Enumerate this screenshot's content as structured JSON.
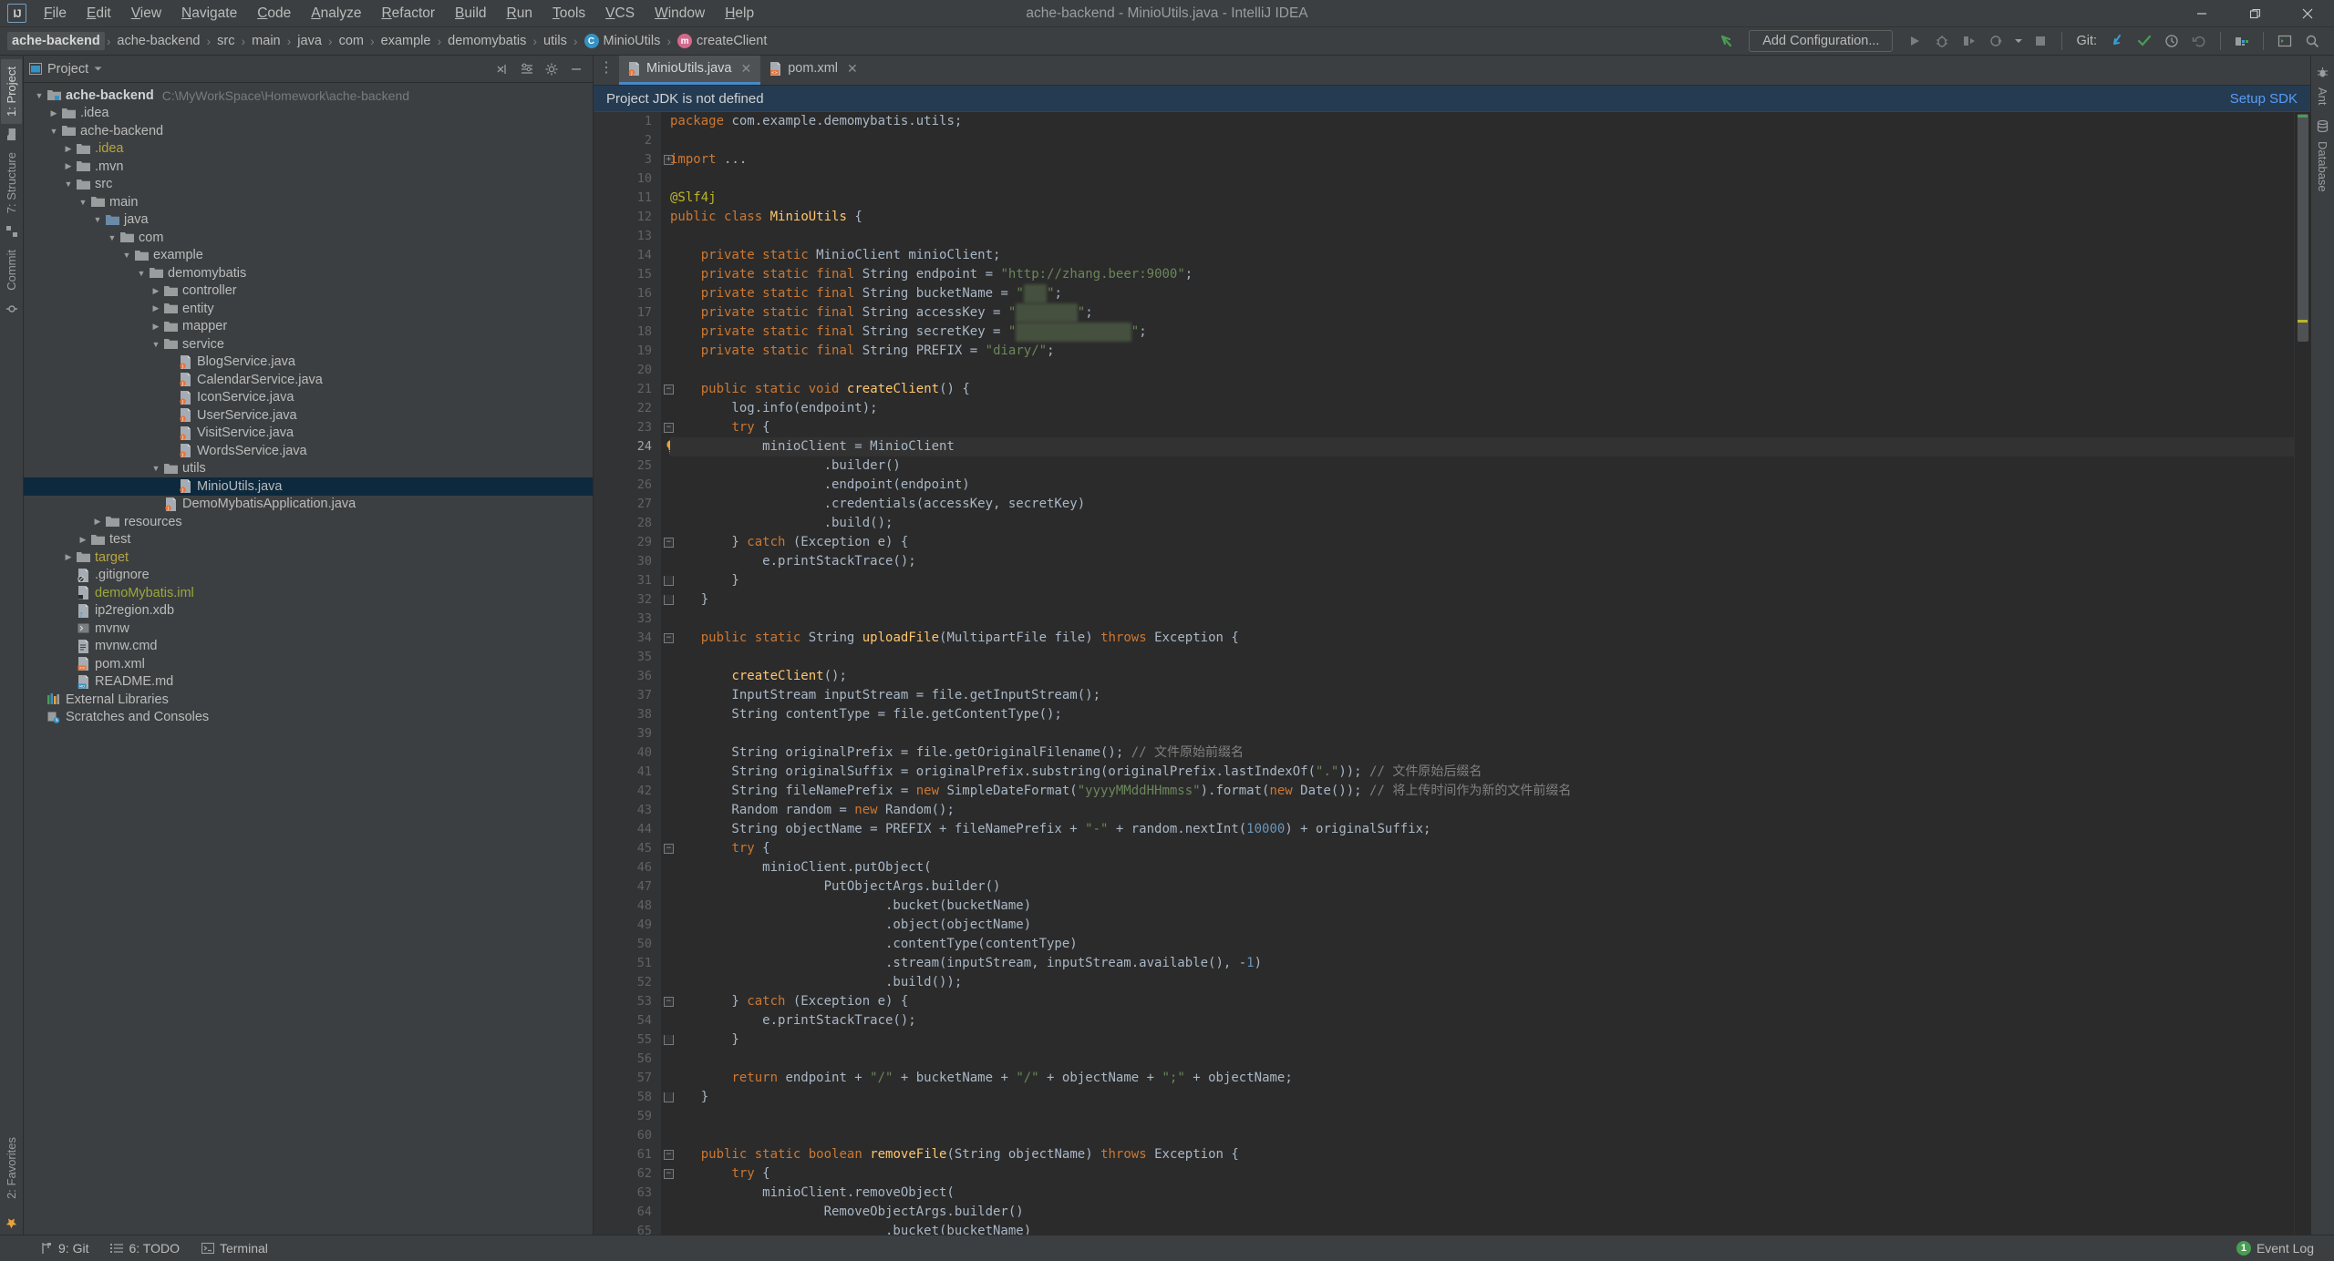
{
  "window": {
    "title": "ache-backend - MinioUtils.java - IntelliJ IDEA",
    "logo": "IJ",
    "minimize": "—",
    "maximize": "❐",
    "close": "✕"
  },
  "menu": {
    "items": [
      "File",
      "Edit",
      "View",
      "Navigate",
      "Code",
      "Analyze",
      "Refactor",
      "Build",
      "Run",
      "Tools",
      "VCS",
      "Window",
      "Help"
    ]
  },
  "breadcrumb": {
    "items": [
      {
        "label": "ache-backend",
        "icon": "",
        "active": true
      },
      {
        "label": "ache-backend",
        "icon": ""
      },
      {
        "label": "src",
        "icon": ""
      },
      {
        "label": "main",
        "icon": ""
      },
      {
        "label": "java",
        "icon": ""
      },
      {
        "label": "com",
        "icon": ""
      },
      {
        "label": "example",
        "icon": ""
      },
      {
        "label": "demomybatis",
        "icon": ""
      },
      {
        "label": "utils",
        "icon": ""
      },
      {
        "label": "MinioUtils",
        "icon": "class-icon",
        "glyph": "C"
      },
      {
        "label": "createClient",
        "icon": "method-icon",
        "glyph": "m"
      }
    ],
    "separator": "›"
  },
  "toolbar": {
    "back_arrow": "back-arrow-icon",
    "run_config": "Add Configuration...",
    "git_label": "Git:",
    "buttons": [
      "run-button",
      "debug-button",
      "run-with-coverage-button",
      "profiler-button",
      "stop-button"
    ],
    "git_buttons": [
      "update-project-button",
      "commit-button",
      "history-button",
      "rollback-button"
    ],
    "right_buttons": [
      "settings-button",
      "layout-button",
      "search-button"
    ]
  },
  "project_panel": {
    "title": "Project",
    "tools": [
      "collapse-all-icon",
      "expand-settings-icon",
      "gear-icon",
      "hide-icon"
    ],
    "tree": [
      {
        "depth": 0,
        "arrow": "down",
        "icon": "module",
        "label": "ache-backend",
        "bold": true,
        "path": "C:\\MyWorkSpace\\Homework\\ache-backend"
      },
      {
        "depth": 1,
        "arrow": "right",
        "icon": "folder",
        "label": ".idea"
      },
      {
        "depth": 1,
        "arrow": "down",
        "icon": "folder",
        "label": "ache-backend"
      },
      {
        "depth": 2,
        "arrow": "right",
        "icon": "folder",
        "label": ".idea",
        "color": "yellow"
      },
      {
        "depth": 2,
        "arrow": "right",
        "icon": "folder",
        "label": ".mvn"
      },
      {
        "depth": 2,
        "arrow": "down",
        "icon": "folder",
        "label": "src"
      },
      {
        "depth": 3,
        "arrow": "down",
        "icon": "folder",
        "label": "main"
      },
      {
        "depth": 4,
        "arrow": "down",
        "icon": "folder-src",
        "label": "java"
      },
      {
        "depth": 5,
        "arrow": "down",
        "icon": "package",
        "label": "com"
      },
      {
        "depth": 6,
        "arrow": "down",
        "icon": "package",
        "label": "example"
      },
      {
        "depth": 7,
        "arrow": "down",
        "icon": "package",
        "label": "demomybatis"
      },
      {
        "depth": 8,
        "arrow": "right",
        "icon": "package",
        "label": "controller"
      },
      {
        "depth": 8,
        "arrow": "right",
        "icon": "package",
        "label": "entity"
      },
      {
        "depth": 8,
        "arrow": "right",
        "icon": "package",
        "label": "mapper"
      },
      {
        "depth": 8,
        "arrow": "down",
        "icon": "package",
        "label": "service"
      },
      {
        "depth": 9,
        "arrow": "none",
        "icon": "java",
        "label": "BlogService.java"
      },
      {
        "depth": 9,
        "arrow": "none",
        "icon": "java",
        "label": "CalendarService.java"
      },
      {
        "depth": 9,
        "arrow": "none",
        "icon": "java",
        "label": "IconService.java"
      },
      {
        "depth": 9,
        "arrow": "none",
        "icon": "java",
        "label": "UserService.java"
      },
      {
        "depth": 9,
        "arrow": "none",
        "icon": "java",
        "label": "VisitService.java"
      },
      {
        "depth": 9,
        "arrow": "none",
        "icon": "java",
        "label": "WordsService.java"
      },
      {
        "depth": 8,
        "arrow": "down",
        "icon": "package",
        "label": "utils"
      },
      {
        "depth": 9,
        "arrow": "none",
        "icon": "java",
        "label": "MinioUtils.java",
        "selected": true
      },
      {
        "depth": 8,
        "arrow": "none",
        "icon": "java",
        "label": "DemoMybatisApplication.java"
      },
      {
        "depth": 4,
        "arrow": "right",
        "icon": "folder-res",
        "label": "resources"
      },
      {
        "depth": 3,
        "arrow": "right",
        "icon": "folder",
        "label": "test"
      },
      {
        "depth": 2,
        "arrow": "right",
        "icon": "folder",
        "label": "target",
        "color": "yellow"
      },
      {
        "depth": 2,
        "arrow": "none",
        "icon": "gitignore",
        "label": ".gitignore"
      },
      {
        "depth": 2,
        "arrow": "none",
        "icon": "iml",
        "label": "demoMybatis.iml",
        "color": "green"
      },
      {
        "depth": 2,
        "arrow": "none",
        "icon": "xdb",
        "label": "ip2region.xdb"
      },
      {
        "depth": 2,
        "arrow": "none",
        "icon": "script",
        "label": "mvnw"
      },
      {
        "depth": 2,
        "arrow": "none",
        "icon": "cmd",
        "label": "mvnw.cmd"
      },
      {
        "depth": 2,
        "arrow": "none",
        "icon": "xml",
        "label": "pom.xml"
      },
      {
        "depth": 2,
        "arrow": "none",
        "icon": "md",
        "label": "README.md"
      },
      {
        "depth": 0,
        "arrow": "none",
        "icon": "libs",
        "label": "External Libraries"
      },
      {
        "depth": 0,
        "arrow": "none",
        "icon": "scratches",
        "label": "Scratches and Consoles"
      }
    ]
  },
  "tool_windows": {
    "left": [
      "1: Project",
      "7: Structure",
      "Commit"
    ],
    "right": [
      "Ant",
      "Database"
    ],
    "bottom_left_vertical": "2: Favorites"
  },
  "editor": {
    "tabs": [
      {
        "label": "MinioUtils.java",
        "icon": "java-file-icon",
        "active": true,
        "close": "✕"
      },
      {
        "label": "pom.xml",
        "icon": "xml-file-icon",
        "active": false,
        "close": "✕"
      }
    ],
    "notification": {
      "message": "Project JDK is not defined",
      "action": "Setup SDK"
    },
    "current_line": 24,
    "line_numbers": [
      1,
      2,
      3,
      10,
      11,
      12,
      13,
      14,
      15,
      16,
      17,
      18,
      19,
      20,
      21,
      22,
      23,
      24,
      25,
      26,
      27,
      28,
      29,
      30,
      31,
      32,
      33,
      34,
      35,
      36,
      37,
      38,
      39,
      40,
      41,
      42,
      43,
      44,
      45,
      46,
      47,
      48,
      49,
      50,
      51,
      52,
      53,
      54,
      55,
      56,
      57,
      58,
      59,
      60,
      61,
      62,
      63,
      64,
      65
    ],
    "code": [
      "package com.example.demomybatis.utils;",
      "",
      "import ...",
      "",
      "@Slf4j",
      "public class MinioUtils {",
      "",
      "    private static MinioClient minioClient;",
      "    private static final String endpoint = \"http://zhang.beer:9000\";",
      "    private static final String bucketName = \"    \";",
      "    private static final String accessKey = \"          \";",
      "    private static final String secretKey = \"                  \";",
      "    private static final String PREFIX = \"diary/\";",
      "",
      "    public static void createClient() {",
      "        log.info(endpoint);",
      "        try {",
      "            minioClient = MinioClient",
      "                    .builder()",
      "                    .endpoint(endpoint)",
      "                    .credentials(accessKey, secretKey)",
      "                    .build();",
      "        } catch (Exception e) {",
      "            e.printStackTrace();",
      "        }",
      "    }",
      "",
      "    public static String uploadFile(MultipartFile file) throws Exception {",
      "",
      "        createClient();",
      "        InputStream inputStream = file.getInputStream();",
      "        String contentType = file.getContentType();",
      "",
      "        String originalPrefix = file.getOriginalFilename(); // 文件原始前缀名",
      "        String originalSuffix = originalPrefix.substring(originalPrefix.lastIndexOf(\".\")); // 文件原始后缀名",
      "        String fileNamePrefix = new SimpleDateFormat(\"yyyyMMddHHmmss\").format(new Date()); // 将上传时间作为新的文件前缀名",
      "        Random random = new Random();",
      "        String objectName = PREFIX + fileNamePrefix + \"-\" + random.nextInt(10000) + originalSuffix;",
      "        try {",
      "            minioClient.putObject(",
      "                    PutObjectArgs.builder()",
      "                            .bucket(bucketName)",
      "                            .object(objectName)",
      "                            .contentType(contentType)",
      "                            .stream(inputStream, inputStream.available(), -1)",
      "                            .build());",
      "        } catch (Exception e) {",
      "            e.printStackTrace();",
      "        }",
      "",
      "        return endpoint + \"/\" + bucketName + \"/\" + objectName + \";\" + objectName;",
      "    }",
      "",
      "",
      "    public static boolean removeFile(String objectName) throws Exception {",
      "        try {",
      "            minioClient.removeObject(",
      "                    RemoveObjectArgs.builder()",
      "                            .bucket(bucketName)"
    ]
  },
  "statusbar": {
    "left_items": [
      {
        "label": "9: Git",
        "underline": "9",
        "icon": "git-branch-icon"
      },
      {
        "label": "6: TODO",
        "underline": "6",
        "icon": "todo-list-icon"
      },
      {
        "label": "Terminal",
        "icon": "terminal-icon"
      }
    ],
    "event_log": {
      "label": "Event Log",
      "count": "1"
    }
  }
}
